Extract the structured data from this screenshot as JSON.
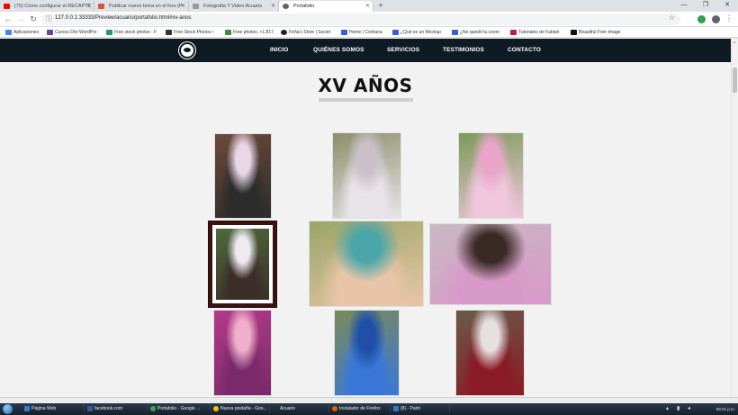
{
  "browser": {
    "tabs": [
      {
        "label": "(79) Cómo configurar el RECAPTC",
        "favicon_color": "#ff0000",
        "active": false
      },
      {
        "label": "Publicar nuevo tema en el foro (P",
        "favicon_color": "#e0533b",
        "active": false
      },
      {
        "label": "Fotografia Y Video Acuario",
        "favicon_color": "#6a6a6a",
        "active": false
      },
      {
        "label": "Portafolio",
        "favicon_color": "#5f6368",
        "active": true
      }
    ],
    "url": "127.0.0.1:33333/Preview/acuario/portafolio.html#xv-anos",
    "bookmarks": [
      {
        "label": "Aplicaciones",
        "color": "#4285f4"
      },
      {
        "label": "Cursos Divi WordPre",
        "color": "#6b3fa0"
      },
      {
        "label": "Free stock photos - F",
        "color": "#1a9e6b"
      },
      {
        "label": "Free Stock Photos •",
        "color": "#333333"
      },
      {
        "label": "Free photos, +1.817",
        "color": "#3d8b3d"
      },
      {
        "label": "Feña's Store | Societ",
        "color": "#222222"
      },
      {
        "label": "Home | Crehana",
        "color": "#3b5bdb"
      },
      {
        "label": "¿Qué es un Mockup",
        "color": "#3b5bdb"
      },
      {
        "label": "¿No quedó tu cover:",
        "color": "#3b5bdb"
      },
      {
        "label": "Tutoriales de Fabian",
        "color": "#c2185b"
      },
      {
        "label": "Beautiful Free Image",
        "color": "#111111"
      }
    ]
  },
  "site": {
    "nav": [
      "INICIO",
      "QUIÉNES SOMOS",
      "SERVICIOS",
      "TESTIMONIOS",
      "CONTACTO"
    ],
    "section_title": "XV AÑOS",
    "photos": [
      {
        "alt": "quinceañera-con-acompañante",
        "colors": [
          "#6b4a3a",
          "#2c2c2c",
          "#e9d6e6"
        ]
      },
      {
        "alt": "vestido-blanco-corona",
        "colors": [
          "#8a8f6a",
          "#e8e4ea",
          "#c9c0c9"
        ]
      },
      {
        "alt": "vestido-rosa-ramo",
        "colors": [
          "#7a9a58",
          "#f0c6dd",
          "#e8a5c9"
        ]
      },
      {
        "alt": "foto-con-caballo",
        "colors": [
          "#4e6a3c",
          "#3b2e28",
          "#eeeaf0"
        ]
      },
      {
        "alt": "collage-maquillaje",
        "colors": [
          "#9aa566",
          "#e8c5a8",
          "#4aa6a8"
        ]
      },
      {
        "alt": "retrato-recostada-flores",
        "colors": [
          "#c9b8c2",
          "#d79ac8",
          "#3a2a26"
        ]
      },
      {
        "alt": "vestido-fucsia-flores",
        "colors": [
          "#b23a8a",
          "#7a2a6a",
          "#f0b0cc"
        ]
      },
      {
        "alt": "vestido-azul",
        "colors": [
          "#7a8a5a",
          "#3a78d8",
          "#1f4fa8"
        ]
      },
      {
        "alt": "vestido-rojo-ramo",
        "colors": [
          "#6a5a48",
          "#8a1a24",
          "#e6e0e0"
        ]
      }
    ]
  },
  "taskbar": {
    "items": [
      {
        "label": "Página Web",
        "color": "#2f7fd0"
      },
      {
        "label": "facebook.com",
        "color": "#3b5998"
      },
      {
        "label": "Portafolio - Google ...",
        "color": "#34a853"
      },
      {
        "label": "Nueva pestaña - Goo...",
        "color": "#fbbc05"
      },
      {
        "label": "Acuario",
        "color": "#2b2b2b"
      },
      {
        "label": "Instalador de Firefox",
        "color": "#e66000"
      },
      {
        "label": "(8) - Paint",
        "color": "#2a7cc7"
      }
    ],
    "clock": "08:21 p.m.",
    "date": ""
  }
}
